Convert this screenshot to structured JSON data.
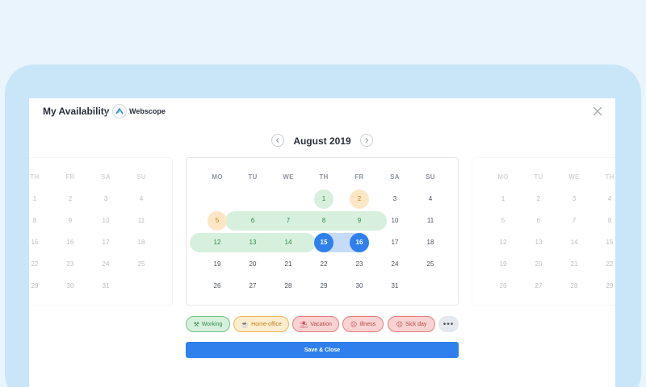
{
  "header": {
    "title": "My Availability",
    "workspace_name": "Webscope"
  },
  "month_nav": {
    "title": "August 2019",
    "prev_icon": "chevron-left-icon",
    "next_icon": "chevron-right-icon"
  },
  "main_calendar": {
    "weekdays": [
      "MO",
      "TU",
      "WE",
      "TH",
      "FR",
      "SA",
      "SU"
    ],
    "weeks": [
      [
        "",
        "",
        "",
        "1",
        "2",
        "3",
        "4"
      ],
      [
        "5",
        "6",
        "7",
        "8",
        "9",
        "10",
        "11"
      ],
      [
        "12",
        "13",
        "14",
        "15",
        "16",
        "17",
        "18"
      ],
      [
        "19",
        "20",
        "21",
        "22",
        "23",
        "24",
        "25"
      ],
      [
        "26",
        "27",
        "28",
        "29",
        "30",
        "31",
        ""
      ]
    ],
    "marks": {
      "1": "working",
      "2": "home-office",
      "5": "home-office",
      "6": "working",
      "7": "working",
      "8": "working",
      "9": "working",
      "12": "working",
      "13": "working",
      "14": "working",
      "15": "selected",
      "16": "selected"
    }
  },
  "left_calendar": {
    "weekdays": [
      "TH",
      "FR",
      "SA",
      "SU"
    ],
    "weeks": [
      [
        "1",
        "2",
        "3",
        "4"
      ],
      [
        "8",
        "9",
        "10",
        "11"
      ],
      [
        "15",
        "16",
        "17",
        "18"
      ],
      [
        "22",
        "23",
        "24",
        "25"
      ],
      [
        "29",
        "30",
        "31",
        ""
      ]
    ]
  },
  "right_calendar": {
    "weekdays": [
      "MO",
      "TU",
      "WE",
      "TH"
    ],
    "weeks": [
      [
        "1",
        "2",
        "3",
        "4"
      ],
      [
        "5",
        "6",
        "7",
        "8"
      ],
      [
        "12",
        "13",
        "14",
        "15"
      ],
      [
        "19",
        "20",
        "21",
        "22"
      ],
      [
        "26",
        "27",
        "28",
        "29"
      ]
    ]
  },
  "legend": {
    "working": "Working",
    "home_office": "Home-office",
    "vacation": "Vacation",
    "illness": "Illness",
    "sick_day": "Sick day",
    "more": "•••"
  },
  "actions": {
    "save_label": "Save & Close"
  },
  "colors": {
    "accent": "#2f80ed",
    "working": "#d7f0dd",
    "home_office": "#fde6c6",
    "vacation": "#f9d3d3"
  }
}
